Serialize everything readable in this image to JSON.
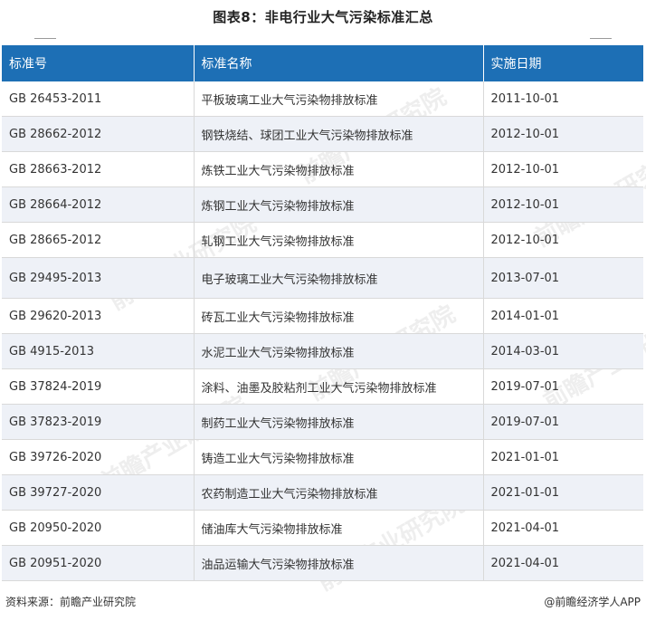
{
  "title": "图表8：非电行业大气污染标准汇总",
  "table": {
    "headers": [
      "标准号",
      "标准名称",
      "实施日期"
    ],
    "rows": [
      [
        "GB 26453-2011",
        "平板玻璃工业大气污染物排放标准",
        "2011-10-01"
      ],
      [
        "GB 28662-2012",
        "钢铁烧结、球团工业大气污染物排放标准",
        "2012-10-01"
      ],
      [
        "GB 28663-2012",
        "炼铁工业大气污染物排放标准",
        "2012-10-01"
      ],
      [
        "GB 28664-2012",
        "炼钢工业大气污染物排放标准",
        "2012-10-01"
      ],
      [
        "GB 28665-2012",
        "轧钢工业大气污染物排放标准",
        "2012-10-01"
      ],
      [
        "GB 29495-2013",
        "电子玻璃工业大气污染物排放标准",
        "2013-07-01"
      ],
      [
        "GB 29620-2013",
        "砖瓦工业大气污染物排放标准",
        "2014-01-01"
      ],
      [
        "GB 4915-2013",
        "水泥工业大气污染物排放标准",
        "2014-03-01"
      ],
      [
        "GB 37824-2019",
        "涂料、油墨及胶粘剂工业大气污染物排放标准",
        "2019-07-01"
      ],
      [
        "GB 37823-2019",
        "制药工业大气污染物排放标准",
        "2019-07-01"
      ],
      [
        "GB 39726-2020",
        "铸造工业大气污染物排放标准",
        "2021-01-01"
      ],
      [
        "GB 39727-2020",
        "农药制造工业大气污染物排放标准",
        "2021-01-01"
      ],
      [
        "GB 20950-2020",
        "储油库大气污染物排放标准",
        "2021-04-01"
      ],
      [
        "GB 20951-2020",
        "油品运输大气污染物排放标准",
        "2021-04-01"
      ]
    ]
  },
  "watermark_text": "前瞻产业研究院",
  "footer": {
    "source": "资料来源：前瞻产业研究院",
    "brand": "@前瞻经济学人APP"
  },
  "colors": {
    "header_bg": "#1d6fb5",
    "stripe_bg": "#eef1f7"
  }
}
